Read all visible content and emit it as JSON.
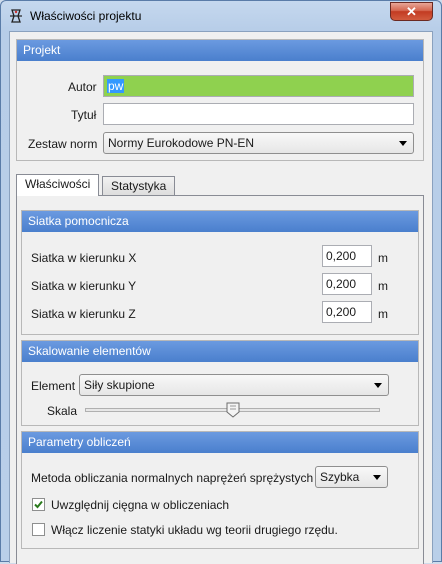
{
  "window": {
    "title": "Właściwości projektu",
    "close_symbol": "✕"
  },
  "project": {
    "header": "Projekt",
    "author_label": "Autor",
    "author_value": "pw",
    "title_label": "Tytuł",
    "title_value": "",
    "norms_label": "Zestaw norm",
    "norms_value": "Normy Eurokodowe PN-EN",
    "accent_color": "#8fd14f"
  },
  "tabs": [
    {
      "label": "Właściwości",
      "active": true
    },
    {
      "label": "Statystyka",
      "active": false
    }
  ],
  "grid": {
    "header": "Siatka pomocnicza",
    "rows": [
      {
        "label": "Siatka w kierunku X",
        "value": "0,200",
        "unit": "m"
      },
      {
        "label": "Siatka w kierunku Y",
        "value": "0,200",
        "unit": "m"
      },
      {
        "label": "Siatka w kierunku Z",
        "value": "0,200",
        "unit": "m"
      }
    ]
  },
  "scaling": {
    "header": "Skalowanie elementów",
    "element_label": "Element",
    "element_value": "Siły skupione",
    "scale_label": "Skala",
    "scale_level": 0.5
  },
  "calc": {
    "header": "Parametry obliczeń",
    "method_label": "Metoda obliczania normalnych naprężeń sprężystych",
    "method_value": "Szybka",
    "tendons_label": "Uwzględnij cięgna w obliczeniach",
    "tendons_checked": true,
    "second_order_label": "Włącz liczenie statyki układu wg teorii drugiego rzędu.",
    "second_order_checked": false
  },
  "colors": {
    "header_bg": "#4a7fcd",
    "check_color": "#2a7a1c"
  }
}
